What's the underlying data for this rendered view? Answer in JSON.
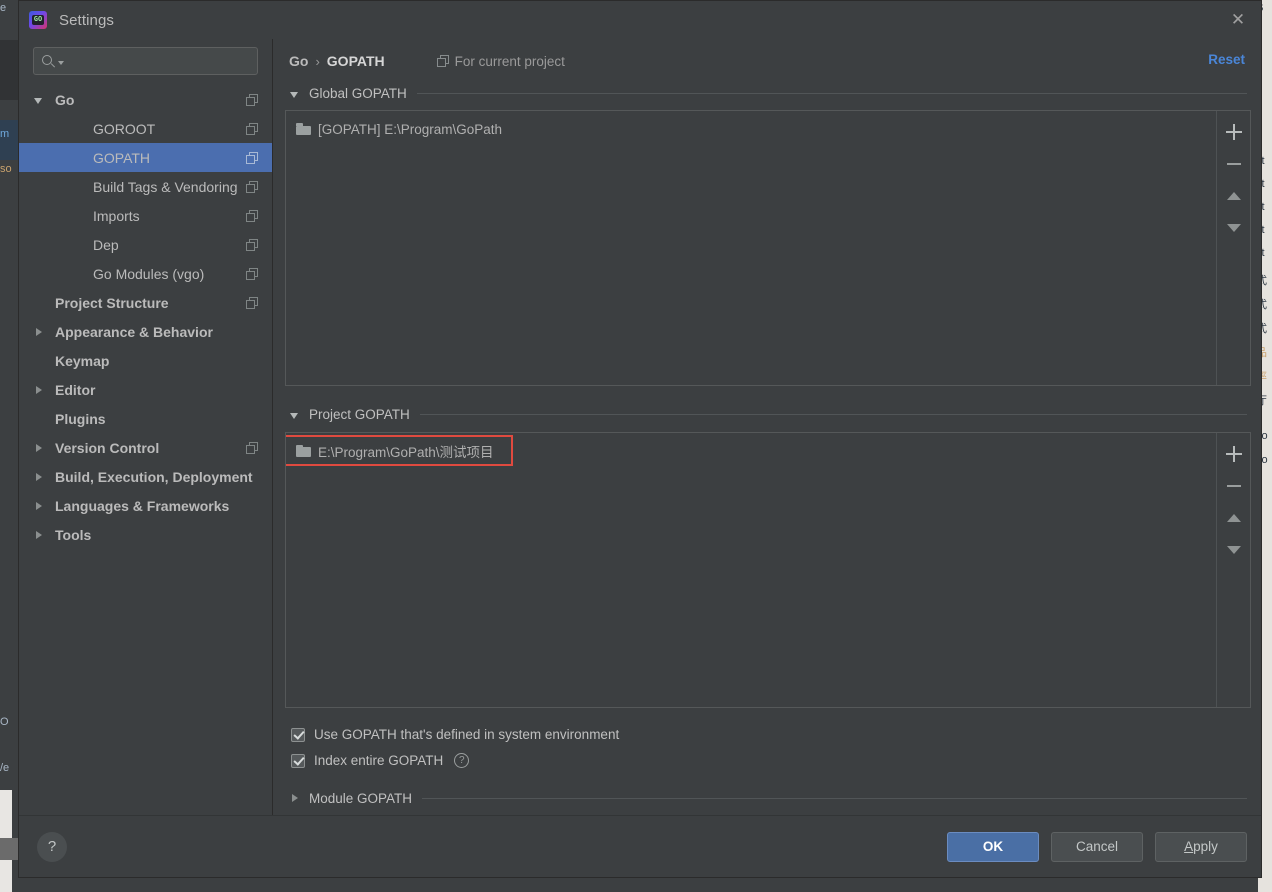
{
  "background": {
    "left_fragments": [
      "e",
      "m",
      "so",
      "O",
      "/e"
    ],
    "right_fragments": [
      "S",
      "ct",
      "ct",
      "ct",
      "ct",
      "ct",
      "式",
      "式",
      "式",
      "品",
      "率",
      "厅",
      "co",
      "co"
    ]
  },
  "window": {
    "title": "Settings",
    "app_icon": "goland-icon",
    "close_label": "✕"
  },
  "sidebar": {
    "search": {
      "value": "",
      "placeholder": ""
    },
    "items": [
      {
        "label": "Go",
        "indent": 0,
        "twisty": "expanded",
        "bold": true,
        "copy": true,
        "selected": false
      },
      {
        "label": "GOROOT",
        "indent": 1,
        "twisty": "none",
        "bold": false,
        "copy": true,
        "selected": false
      },
      {
        "label": "GOPATH",
        "indent": 1,
        "twisty": "none",
        "bold": false,
        "copy": true,
        "selected": true
      },
      {
        "label": "Build Tags & Vendoring",
        "indent": 1,
        "twisty": "none",
        "bold": false,
        "copy": true,
        "selected": false
      },
      {
        "label": "Imports",
        "indent": 1,
        "twisty": "none",
        "bold": false,
        "copy": true,
        "selected": false
      },
      {
        "label": "Dep",
        "indent": 1,
        "twisty": "none",
        "bold": false,
        "copy": true,
        "selected": false
      },
      {
        "label": "Go Modules (vgo)",
        "indent": 1,
        "twisty": "none",
        "bold": false,
        "copy": true,
        "selected": false
      },
      {
        "label": "Project Structure",
        "indent": 0,
        "twisty": "none",
        "bold": true,
        "copy": true,
        "selected": false
      },
      {
        "label": "Appearance & Behavior",
        "indent": 0,
        "twisty": "collapsed",
        "bold": true,
        "copy": false,
        "selected": false
      },
      {
        "label": "Keymap",
        "indent": 0,
        "twisty": "none",
        "bold": true,
        "copy": false,
        "selected": false
      },
      {
        "label": "Editor",
        "indent": 0,
        "twisty": "collapsed",
        "bold": true,
        "copy": false,
        "selected": false
      },
      {
        "label": "Plugins",
        "indent": 0,
        "twisty": "none",
        "bold": true,
        "copy": false,
        "selected": false
      },
      {
        "label": "Version Control",
        "indent": 0,
        "twisty": "collapsed",
        "bold": true,
        "copy": true,
        "selected": false
      },
      {
        "label": "Build, Execution, Deployment",
        "indent": 0,
        "twisty": "collapsed",
        "bold": true,
        "copy": false,
        "selected": false
      },
      {
        "label": "Languages & Frameworks",
        "indent": 0,
        "twisty": "collapsed",
        "bold": true,
        "copy": false,
        "selected": false
      },
      {
        "label": "Tools",
        "indent": 0,
        "twisty": "collapsed",
        "bold": true,
        "copy": false,
        "selected": false
      }
    ]
  },
  "main": {
    "breadcrumb": {
      "parent": "Go",
      "separator": "›",
      "current": "GOPATH"
    },
    "scope_label": "For current project",
    "reset_label": "Reset",
    "global_section": {
      "title": "Global GOPATH",
      "expanded": true,
      "entries": [
        {
          "label": "[GOPATH] E:\\Program\\GoPath"
        }
      ]
    },
    "project_section": {
      "title": "Project GOPATH",
      "expanded": true,
      "entries": [
        {
          "label": "E:\\Program\\GoPath\\测试项目",
          "highlighted": true
        }
      ]
    },
    "toolbar": {
      "add": "add-button",
      "remove": "remove-button",
      "move_up": "move-up-button",
      "move_down": "move-down-button"
    },
    "checkboxes": [
      {
        "label": "Use GOPATH that's defined in system environment",
        "checked": true,
        "help": false
      },
      {
        "label": "Index entire GOPATH",
        "checked": true,
        "help": true
      }
    ],
    "module_section": {
      "title": "Module GOPATH",
      "expanded": false
    }
  },
  "footer": {
    "help_label": "?",
    "ok_label": "OK",
    "cancel_label": "Cancel",
    "apply_label": "Apply",
    "apply_mnemonic": "A",
    "apply_rest": "pply"
  },
  "colors": {
    "accent": "#4b6eaf",
    "primary_button": "#4a6fa5",
    "link": "#4a86d8",
    "highlight_box": "#e04a3f",
    "dialog_bg": "#3c3f41"
  }
}
